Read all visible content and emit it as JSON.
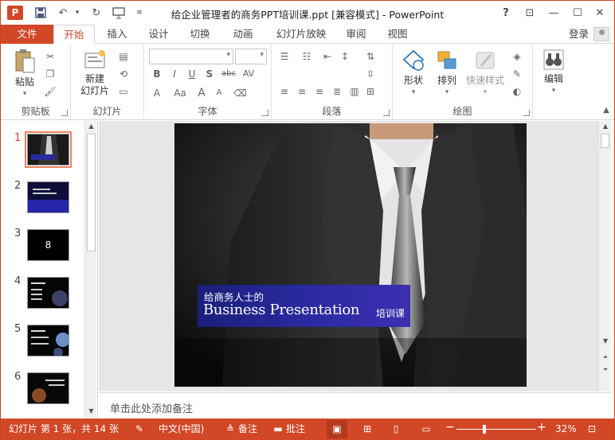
{
  "window": {
    "title": "给企业管理者的商务PPT培训课.ppt [兼容模式] - PowerPoint",
    "app_letter": "P",
    "accent_color": "#d24726",
    "controls": [
      "?",
      "⊡",
      "—",
      "☐",
      "✕"
    ]
  },
  "tabs": {
    "file": "文件",
    "items": [
      "开始",
      "插入",
      "设计",
      "切换",
      "动画",
      "幻灯片放映",
      "审阅",
      "视图"
    ],
    "active": "开始",
    "login": "登录"
  },
  "ribbon": {
    "clipboard": {
      "paste": "粘贴",
      "label": "剪贴板"
    },
    "slides": {
      "new_slide_line1": "新建",
      "new_slide_line2": "幻灯片",
      "label": "幻灯片"
    },
    "font": {
      "label": "字体",
      "bold": "B",
      "italic": "I",
      "underline": "U",
      "shadow": "S",
      "strike": "abc",
      "spacing": "AV",
      "case": "Aa",
      "size_up": "A",
      "size_down": "A"
    },
    "paragraph": {
      "label": "段落"
    },
    "drawing": {
      "shapes": "形状",
      "arrange": "排列",
      "quick_styles": "快速样式",
      "label": "绘图"
    },
    "editing": {
      "label": "编辑"
    }
  },
  "thumbnails": {
    "numbers": [
      "1",
      "2",
      "3",
      "4",
      "5",
      "6"
    ],
    "active_index": 0,
    "slide3_text": "8"
  },
  "slide": {
    "banner_subtitle": "给商务人士的",
    "banner_title": "Business Presentation",
    "banner_tail": "培训课"
  },
  "notes": {
    "placeholder": "单击此处添加备注"
  },
  "status": {
    "slide_info": "幻灯片 第 1 张，共 14 张",
    "language": "中文(中国)",
    "notes": "备注",
    "comments": "批注",
    "zoom": "32%",
    "zoom_minus": "−",
    "zoom_plus": "+"
  }
}
